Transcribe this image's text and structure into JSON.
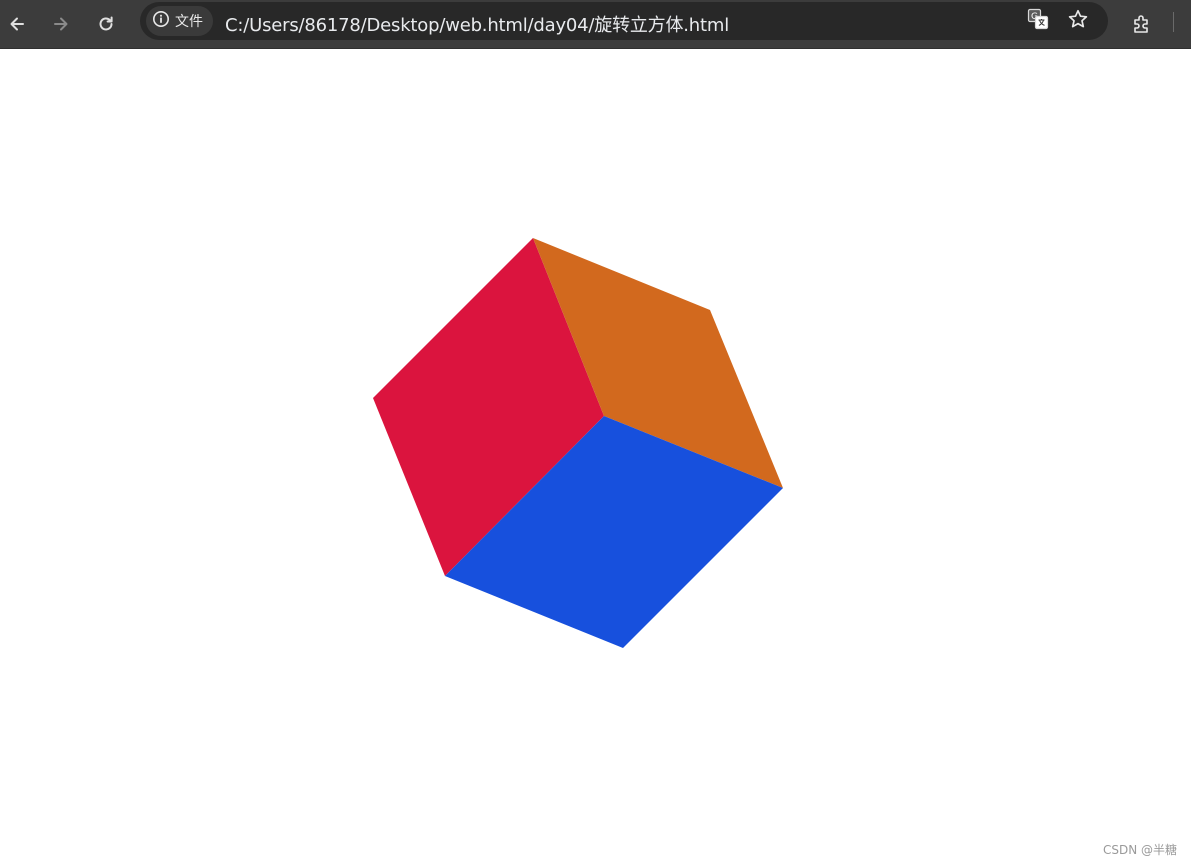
{
  "browser": {
    "site_chip_label": "文件",
    "url": "C:/Users/86178/Desktop/web.html/day04/旋转立方体.html",
    "icons": {
      "back": "arrow-left-icon",
      "forward": "arrow-right-icon",
      "reload": "reload-icon",
      "info": "info-icon",
      "translate": "translate-icon",
      "bookmark": "star-icon",
      "extensions": "puzzle-icon"
    }
  },
  "cube": {
    "faces": [
      {
        "name": "left-face",
        "color": "#DB143E"
      },
      {
        "name": "top-face",
        "color": "#D2691E"
      },
      {
        "name": "bottom-face",
        "color": "#1750DD"
      }
    ]
  },
  "watermark": "CSDN @半糖"
}
